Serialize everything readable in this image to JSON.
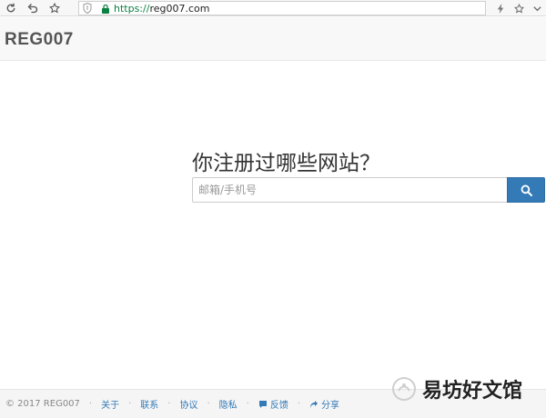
{
  "browser": {
    "url_scheme": "https://",
    "url_host": "reg007.com"
  },
  "header": {
    "brand": "REG007"
  },
  "hero": {
    "title": "你注册过哪些网站？",
    "search_placeholder": "邮箱/手机号"
  },
  "footer": {
    "copyright": "© 2017 REG007",
    "separator": "·",
    "links": {
      "about": "关于",
      "contact": "联系",
      "terms": "协议",
      "privacy": "隐私",
      "feedback": "反馈",
      "share": "分享"
    }
  },
  "watermark": {
    "text": "易坊好文馆"
  },
  "colors": {
    "accent": "#337ab7",
    "secure_green": "#0b8043"
  }
}
